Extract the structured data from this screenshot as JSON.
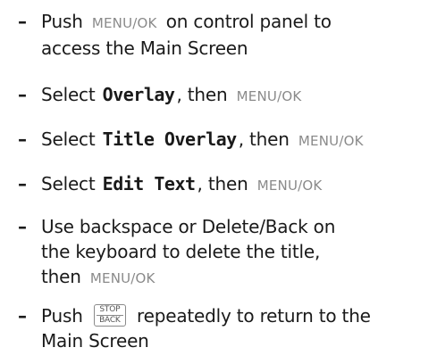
{
  "instructions": [
    {
      "line1": [
        "Push",
        "MENU/OK",
        "on control panel to"
      ],
      "line2": "access the Main Screen"
    },
    {
      "parts": [
        "Select",
        "Overlay",
        ", then",
        "MENU/OK"
      ]
    },
    {
      "parts": [
        "Select",
        "Title Overlay",
        ", then",
        "MENU/OK"
      ]
    },
    {
      "parts": [
        "Select",
        "Edit Text",
        ", then",
        "MENU/OK"
      ]
    },
    {
      "line1": "Use backspace or Delete/Back on",
      "line2": "the keyboard to delete the title,",
      "line3": [
        "then",
        "MENU/OK"
      ]
    },
    {
      "line1": [
        "Push",
        "STOP",
        "BACK",
        "repeatedly to return to the"
      ],
      "line2": "Main Screen"
    }
  ],
  "dash": "–"
}
